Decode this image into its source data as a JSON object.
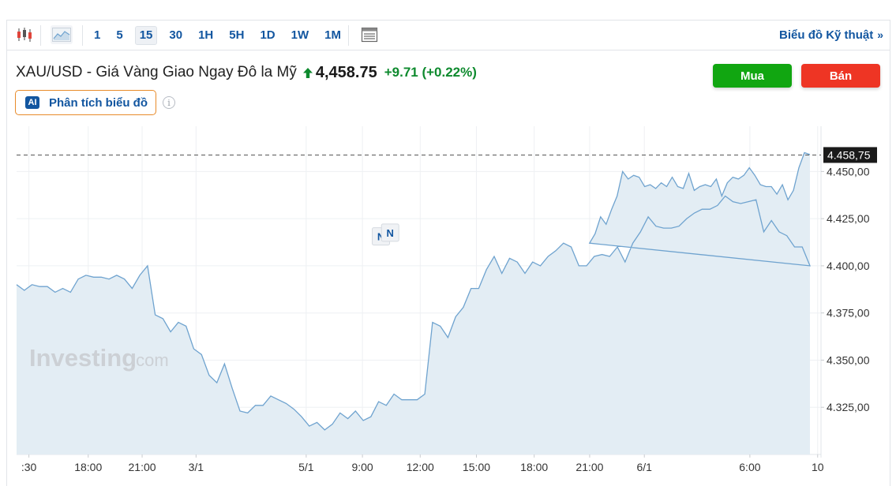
{
  "toolbar": {
    "intervals": [
      "1",
      "5",
      "15",
      "30",
      "1H",
      "5H",
      "1D",
      "1W",
      "1M"
    ],
    "active_interval": "15",
    "tech_chart_link": "Biểu đồ Kỹ thuật",
    "tech_chart_chevron": "»"
  },
  "header": {
    "title": "XAU/USD - Giá Vàng Giao Ngay Đô la Mỹ",
    "price": "4,458.75",
    "change": "+9.71 (+0.22%)",
    "buy_label": "Mua",
    "sell_label": "Bán",
    "ai_badge": "AI",
    "ai_label": "Phân tích biểu đồ",
    "info_glyph": "i"
  },
  "watermark": {
    "brand": "Investing",
    "suffix": ".com"
  },
  "colors": {
    "accent": "#1256a0",
    "buy": "#11a611",
    "sell": "#ee3524",
    "up": "#0e8a2e",
    "line": "#6fa3cf",
    "area": "#e3edf4"
  },
  "icons": {
    "candles": "candlestick-icon",
    "area": "area-chart-icon",
    "layout": "layout-icon",
    "up": "up-arrow-icon",
    "info": "info-icon"
  },
  "chart_data": {
    "type": "area",
    "ylim": [
      4300,
      4474
    ],
    "y_ticks": [
      "4.325,00",
      "4.350,00",
      "4.375,00",
      "4.400,00",
      "4.425,00",
      "4.450,00"
    ],
    "y_tick_values": [
      4325,
      4350,
      4375,
      4400,
      4425,
      4450
    ],
    "x_ticks": [
      ":30",
      "18:00",
      "21:00",
      "3/1",
      "5/1",
      "9:00",
      "12:00",
      "15:00",
      "18:00",
      "21:00",
      "6/1",
      "6:00",
      "10"
    ],
    "x_tick_positions": [
      1.6,
      9.3,
      16.3,
      23.3,
      37.6,
      44.9,
      52.4,
      59.7,
      67.2,
      74.4,
      81.5,
      95.2,
      104
    ],
    "last_price": 4458.75,
    "last_price_label": "4.458,75",
    "event_markers": [
      {
        "label": "N",
        "x": 47.3,
        "y": 4411
      },
      {
        "label": "N",
        "x": 48.5,
        "y": 4413
      }
    ],
    "x": [
      0,
      1,
      2,
      3,
      4,
      5,
      6,
      7,
      8,
      9,
      10,
      11,
      12,
      13,
      14,
      15,
      16,
      17,
      18,
      19,
      20,
      21,
      22,
      23,
      24,
      25,
      26,
      27,
      28,
      29,
      30,
      31,
      32,
      33,
      34,
      35,
      36,
      37,
      38,
      39,
      40,
      41,
      42,
      43,
      44,
      45,
      46,
      47,
      48,
      49,
      50,
      51,
      52,
      53,
      54,
      55,
      56,
      57,
      58,
      59,
      60,
      61,
      62,
      63,
      64,
      65,
      66,
      67,
      68,
      69,
      70,
      71,
      72,
      73,
      74,
      75,
      76,
      77,
      78,
      79,
      80,
      81,
      82,
      83,
      84,
      85,
      86,
      87,
      88,
      89,
      90,
      91,
      92,
      93,
      94,
      95,
      96,
      97,
      98,
      99,
      100,
      101,
      102,
      103
    ],
    "values": [
      4390,
      4387,
      4390,
      4389,
      4389,
      4386,
      4388,
      4386,
      4393,
      4395,
      4394,
      4394,
      4393,
      4395,
      4393,
      4388,
      4395,
      4400,
      4374,
      4372,
      4365,
      4370,
      4368,
      4356,
      4353,
      4342,
      4338,
      4348,
      4335,
      4323,
      4322,
      4326,
      4326,
      4331,
      4329,
      4327,
      4324,
      4320,
      4315,
      4317,
      4313,
      4316,
      4322,
      4319,
      4323,
      4318,
      4320,
      4328,
      4326,
      4332,
      4329,
      4329,
      4329,
      4332,
      4370,
      4368,
      4362,
      4373,
      4378,
      4388,
      4388,
      4398,
      4405,
      4396,
      4404,
      4402,
      4396,
      4402,
      4400,
      4405,
      4408,
      4412,
      4410,
      4400,
      4400,
      4405,
      4406,
      4405,
      4410,
      4402,
      4412,
      4418,
      4426,
      4421,
      4420,
      4420,
      4421,
      4425,
      4428,
      4430,
      4430,
      4432,
      4437,
      4434,
      4433,
      4434,
      4435,
      4418,
      4424,
      4418,
      4416,
      4410,
      4410,
      4400,
      4412,
      4417,
      4426,
      4422,
      4430,
      4437,
      4450,
      4446,
      4448,
      4447,
      4442,
      4443,
      4441,
      4444,
      4442,
      4447,
      4442,
      4441,
      4449,
      4440,
      4442,
      4443,
      4442,
      4446,
      4437,
      4444,
      4447,
      4446,
      4448,
      4452,
      4448,
      4443,
      4442,
      4442,
      4438,
      4443,
      4435,
      4440,
      4452,
      4460,
      4459
    ]
  }
}
